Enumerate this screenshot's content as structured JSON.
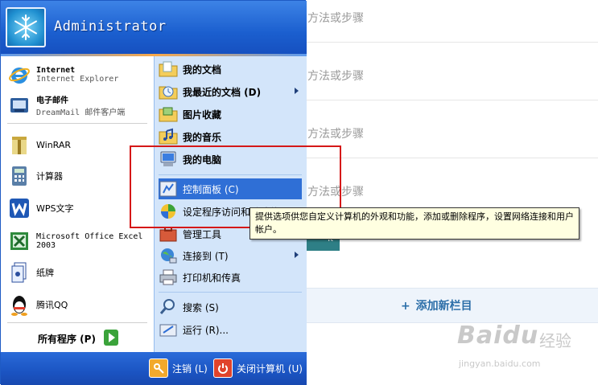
{
  "background_page": {
    "rows": [
      "方法或步骤",
      "方法或步骤",
      "方法或步骤",
      "方法或步骤"
    ],
    "add_section_label": "添加新栏目",
    "add_icon": "plus-icon",
    "button_fragment": "k",
    "watermark": {
      "text": "Baidu",
      "cn": "经验",
      "url": "jingyan.baidu.com"
    }
  },
  "start_menu": {
    "user_name": "Administrator",
    "avatar_icon": "snowflake-icon",
    "pinned": [
      {
        "title": "Internet",
        "subtitle": "Internet Explorer",
        "icon": "internet-explorer-icon"
      },
      {
        "title": "电子邮件",
        "subtitle": "DreamMail 邮件客户端",
        "icon": "email-icon"
      }
    ],
    "recent": [
      {
        "label": "WinRAR",
        "icon": "winrar-icon"
      },
      {
        "label": "计算器",
        "icon": "calculator-icon"
      },
      {
        "label": "WPS文字",
        "icon": "wps-icon"
      },
      {
        "label": "Microsoft Office Excel 2003",
        "icon": "excel-icon"
      },
      {
        "label": "纸牌",
        "icon": "solitaire-icon"
      },
      {
        "label": "腾讯QQ",
        "icon": "qq-icon"
      }
    ],
    "all_programs": "所有程序 (P)",
    "places": [
      {
        "label": "我的文档",
        "icon": "documents-folder-icon",
        "bold": true
      },
      {
        "label": "我最近的文档 (D)",
        "icon": "recent-documents-icon",
        "bold": true,
        "submenu": true
      },
      {
        "label": "图片收藏",
        "icon": "pictures-folder-icon",
        "bold": true
      },
      {
        "label": "我的音乐",
        "icon": "music-folder-icon",
        "bold": true
      },
      {
        "label": "我的电脑",
        "icon": "my-computer-icon",
        "bold": true
      }
    ],
    "system": [
      {
        "label": "控制面板 (C)",
        "icon": "control-panel-icon",
        "selected": true
      },
      {
        "label": "设定程序访问和默认值",
        "icon": "program-defaults-icon"
      },
      {
        "label": "管理工具",
        "icon": "admin-tools-icon"
      },
      {
        "label": "连接到 (T)",
        "icon": "connect-to-icon",
        "submenu": true
      },
      {
        "label": "打印机和传真",
        "icon": "printer-icon"
      }
    ],
    "actions": [
      {
        "label": "搜索 (S)",
        "icon": "search-icon"
      },
      {
        "label": "运行 (R)...",
        "icon": "run-icon"
      }
    ],
    "footer": {
      "logoff": "注销 (L)",
      "shutdown": "关闭计算机 (U)"
    }
  },
  "tooltip": {
    "text": "提供选项供您自定义计算机的外观和功能，添加或删除程序，设置网络连接和用户帐户。"
  },
  "colors": {
    "header_blue": "#1b5fcf",
    "places_pane": "#d3e5fa",
    "selection": "#2f6fd6",
    "highlight_box": "#d51818",
    "tooltip_bg": "#ffffe1"
  }
}
